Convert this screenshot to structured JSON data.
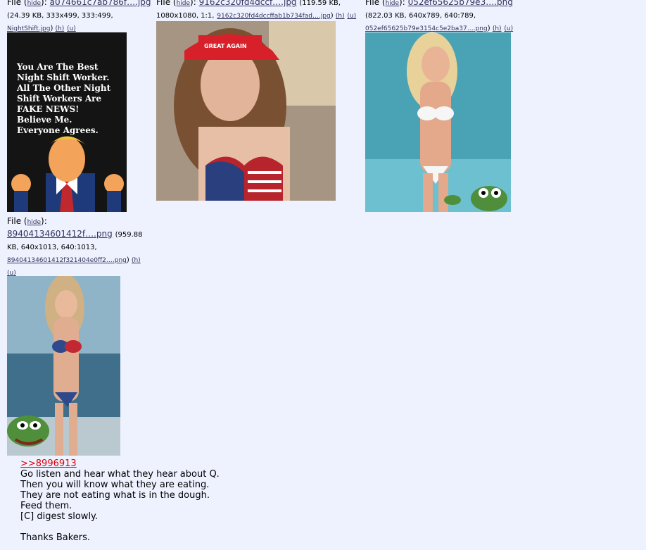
{
  "files": [
    {
      "label": "File (",
      "hide": "hide",
      "sep": "):",
      "filename": "a074661c7ab786f….jpg",
      "meta": "(24.39 KB, 333x499, 333:499,",
      "orig": "NightShift.jpg",
      "h": "(h)",
      "u": "(u)",
      "thumb_text": "You Are The Best Night Shift Worker. All The Other Night Shift Workers Are FAKE NEWS! Believe Me. Everyone Agrees."
    },
    {
      "label": "File (",
      "hide": "hide",
      "sep": "):",
      "filename": "9162c320fd4dccf….jpg",
      "meta": "(119.59 KB, 1080x1080, 1:1,",
      "orig": "9162c320fd4dccffab1b734fad….jpg",
      "h": "(h)",
      "u": "(u)",
      "thumb_text": "GREAT AGAIN"
    },
    {
      "label": "File (",
      "hide": "hide",
      "sep": "):",
      "filename": "052ef65625b79e3….png",
      "meta": "(822.03 KB, 640x789, 640:789,",
      "orig": "052ef65625b79e3154c5e2ba37….png",
      "h": "(h)",
      "u": "(u)"
    },
    {
      "label": "File (",
      "hide": "hide",
      "sep": "):",
      "filename": "89404134601412f….png",
      "meta1": "(959.88",
      "meta2": "KB, 640x1013, 640:1013,",
      "orig": "89404134601412f321404e0ff2….png",
      "h": "(h)",
      "u": "(u)"
    }
  ],
  "post": {
    "quote_link": ">>8996913",
    "lines": [
      "Go listen and hear what they hear about Q.",
      "Then you will know what they are eating.",
      "They are not eating what is in the dough.",
      "Feed them.",
      "[C] digest slowly."
    ],
    "closing": "Thanks Bakers."
  }
}
